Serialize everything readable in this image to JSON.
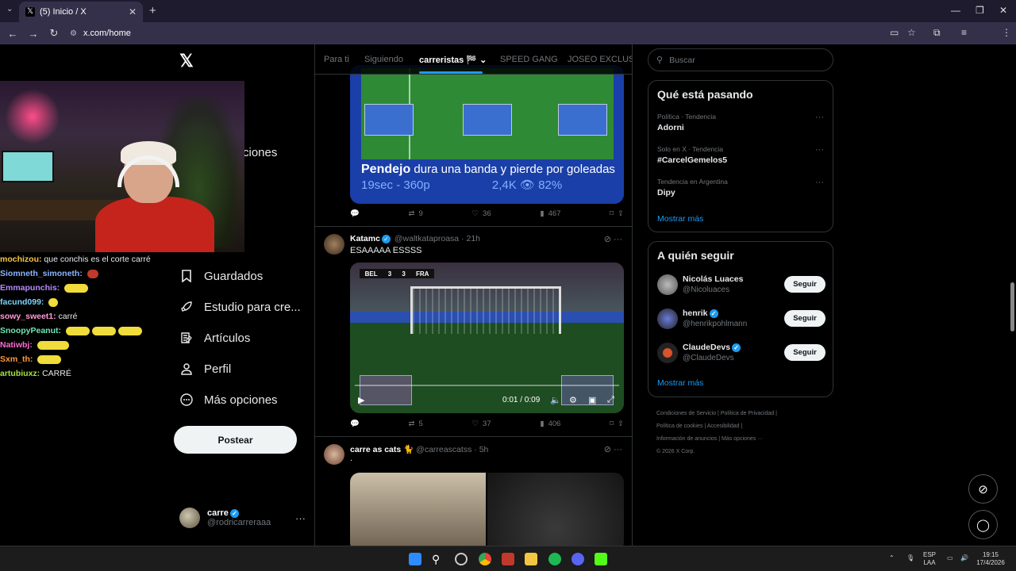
{
  "browser": {
    "tab_title": "(5) Inicio / X",
    "url": "x.com/home"
  },
  "nav": {
    "items": [
      {
        "label": "ciones",
        "icon": "bell-icon"
      },
      {
        "label": "Guardados",
        "icon": "bookmark-icon"
      },
      {
        "label": "Estudio para cre...",
        "icon": "rocket-icon"
      },
      {
        "label": "Artículos",
        "icon": "article-icon"
      },
      {
        "label": "Perfil",
        "icon": "person-icon"
      },
      {
        "label": "Más opciones",
        "icon": "more-circle-icon"
      }
    ],
    "post_button": "Postear",
    "account": {
      "name": "carre",
      "handle": "@rodricarreraaa"
    }
  },
  "chat": [
    {
      "user": "mochizou:",
      "msg": "que conchis es el corte carré",
      "color": "#f6c744"
    },
    {
      "user": "Siomneth_simoneth:",
      "msg": "",
      "color": "#8ab4ff"
    },
    {
      "user": "Emmapunchis:",
      "msg": "",
      "color": "#b48aff"
    },
    {
      "user": "facund099:",
      "msg": "",
      "color": "#7dd3fc"
    },
    {
      "user": "sowy_sweet1:",
      "msg": "carré",
      "color": "#ff9ad5"
    },
    {
      "user": "SnoopyPeanut:",
      "msg": "",
      "color": "#6ee7b7"
    },
    {
      "user": "Natiwbj:",
      "msg": "",
      "color": "#ff6bd6"
    },
    {
      "user": "Sxm_th:",
      "msg": "",
      "color": "#ff9a3c"
    },
    {
      "user": "artubiuxz:",
      "msg": "CARRÉ",
      "color": "#a3e635"
    }
  ],
  "feed": {
    "tabs": [
      "Para ti",
      "Siguiendo",
      "carreristas 🏁",
      "SPEED GANG",
      "JOSEO EXCLUSIV"
    ],
    "active_tab": "carreristas 🏁",
    "post1": {
      "caption_highlight": "Pendejo",
      "caption": "dura una banda y pierde por goleadas",
      "meta_left": "19sec - 360p",
      "meta_right": "2,4K 👁 82%",
      "replies": "",
      "reposts": "9",
      "likes": "36",
      "views": "467"
    },
    "post2": {
      "name": "Katamc",
      "handle": "@waltkataproasa",
      "time": "21h",
      "text": "ESAAAAA ESSSS",
      "score_left": "BEL",
      "score_a": "3",
      "score_b": "3",
      "score_right": "FRA",
      "video_time": "0:01 / 0:09",
      "replies": "",
      "reposts": "5",
      "likes": "37",
      "views": "406"
    },
    "post3": {
      "name": "carre as cats",
      "handle": "@carreascatss",
      "time": "5h",
      "text": "."
    }
  },
  "right": {
    "search_placeholder": "Buscar",
    "trends_title": "Qué está pasando",
    "trends": [
      {
        "context": "Política · Tendencia",
        "name": "Adorni"
      },
      {
        "context": "Solo en X · Tendencia",
        "name": "#CarcelGemelos5"
      },
      {
        "context": "Tendencia en Argentina",
        "name": "Dipy"
      }
    ],
    "show_more": "Mostrar más",
    "follow_title": "A quién seguir",
    "follow": [
      {
        "name": "Nicolás Luaces",
        "handle": "@Nicoluaces",
        "button": "Seguir"
      },
      {
        "name": "henrik",
        "handle": "@henrikpohlmann",
        "button": "Seguir"
      },
      {
        "name": "ClaudeDevs",
        "handle": "@ClaudeDevs",
        "button": "Seguir"
      }
    ],
    "follow_more": "Mostrar más",
    "footer": [
      "Condiciones de Servicio",
      "Política de Privacidad",
      "Política de cookies",
      "Accesibilidad",
      "Información de anuncios",
      "Más opciones ···",
      "© 2026 X Corp."
    ]
  },
  "taskbar": {
    "lang_top": "ESP",
    "lang_bottom": "LAA",
    "time": "19:15",
    "date": "17/4/2026"
  },
  "colors": {
    "accent": "#1d9bf0",
    "background": "#000000"
  }
}
